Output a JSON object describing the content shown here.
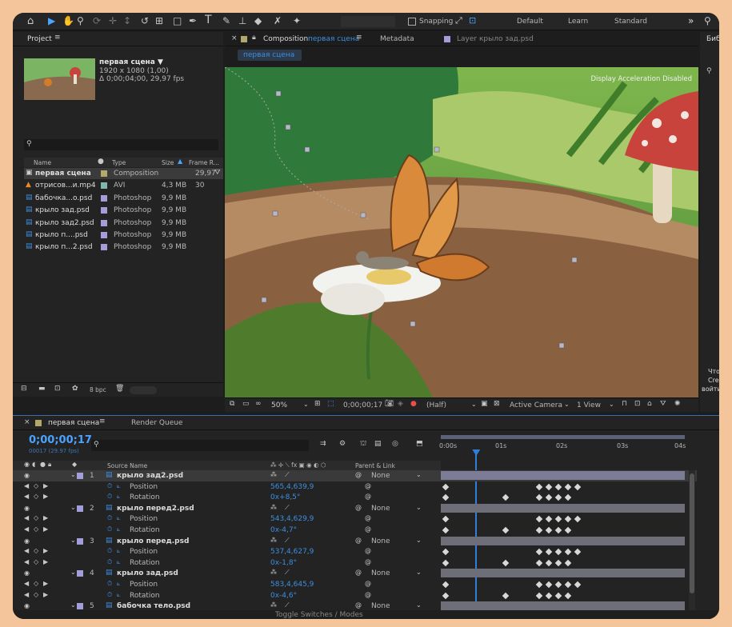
{
  "toolbar": {
    "snapping_label": "Snapping",
    "workspaces": [
      "Default",
      "Learn",
      "Standard"
    ],
    "overflow": "»"
  },
  "project": {
    "tab_label": "Project",
    "comp_name": "первая сцена ▼",
    "comp_info": [
      "1920 x 1080 (1,00)",
      "Δ 0;00;04;00, 29,97 fps"
    ],
    "search_placeholder": "",
    "columns": [
      "Name",
      "Type",
      "Size",
      "Frame R..."
    ],
    "items": [
      {
        "name": "первая сцена",
        "type": "Composition",
        "size": "",
        "fps": "29,97",
        "color": "#b3a86b",
        "kind": "comp"
      },
      {
        "name": "отрисов...и.mp4",
        "type": "AVI",
        "size": "4,3 MB",
        "fps": "30",
        "color": "#7fb7b0",
        "kind": "video"
      },
      {
        "name": "бабочка...o.psd",
        "type": "Photoshop",
        "size": "9,9 MB",
        "fps": "",
        "color": "#a39dd9",
        "kind": "psd"
      },
      {
        "name": "крыло зад.psd",
        "type": "Photoshop",
        "size": "9,9 MB",
        "fps": "",
        "color": "#a39dd9",
        "kind": "psd"
      },
      {
        "name": "крыло зад2.psd",
        "type": "Photoshop",
        "size": "9,9 MB",
        "fps": "",
        "color": "#a39dd9",
        "kind": "psd"
      },
      {
        "name": "крыло п....psd",
        "type": "Photoshop",
        "size": "9,9 MB",
        "fps": "",
        "color": "#a39dd9",
        "kind": "psd"
      },
      {
        "name": "крыло п...2.psd",
        "type": "Photoshop",
        "size": "9,9 MB",
        "fps": "",
        "color": "#a39dd9",
        "kind": "psd"
      }
    ],
    "bpc": "8 bpc"
  },
  "viewer": {
    "tab_composition": "Composition",
    "tab_composition_name": "первая сцена",
    "tab_metadata": "Metadata",
    "tab_layer": "Layer крыло зад.psd",
    "breadcrumb": "первая сцена",
    "overlay": "Display Acceleration Disabled",
    "zoom": "50%",
    "timecode": "0;00;00;17",
    "resolution": "(Half)",
    "camera": "Active Camera",
    "view": "1 View"
  },
  "library": {
    "tab_label": "Библ",
    "side_text": [
      "Чтоб",
      "Creat",
      "войти"
    ]
  },
  "timeline": {
    "tab_comp": "первая сцена",
    "tab_render": "Render Queue",
    "timecode": "0;00;00;17",
    "timecode_sub": "00017 (29.97 fps)",
    "search_placeholder": "",
    "col_source": "Source Name",
    "col_parent": "Parent & Link",
    "ruler": [
      "0:00s",
      "01s",
      "02s",
      "03s",
      "04s"
    ],
    "playhead_fraction": 0.142,
    "footer": "Toggle Switches / Modes",
    "layers": [
      {
        "num": "1",
        "name": "крыло зад2.psd",
        "parent": "None",
        "color": "#a39dd9",
        "selected": true,
        "position": "565,4,639,9",
        "rotation": "0x+8,5°"
      },
      {
        "num": "2",
        "name": "крыло перед2.psd",
        "parent": "None",
        "color": "#a39dd9",
        "selected": false,
        "position": "543,4,629,9",
        "rotation": "0x-4,7°"
      },
      {
        "num": "3",
        "name": "крыло перед.psd",
        "parent": "None",
        "color": "#a39dd9",
        "selected": false,
        "position": "537,4,627,9",
        "rotation": "0x-1,8°"
      },
      {
        "num": "4",
        "name": "крыло зад.psd",
        "parent": "None",
        "color": "#a39dd9",
        "selected": false,
        "position": "583,4,645,9",
        "rotation": "0x-4,6°"
      },
      {
        "num": "5",
        "name": "бабочка тело.psd",
        "parent": "None",
        "color": "#a39dd9",
        "selected": false,
        "position": "",
        "rotation": ""
      }
    ],
    "prop_position": "Position",
    "prop_rotation": "Rotation"
  }
}
